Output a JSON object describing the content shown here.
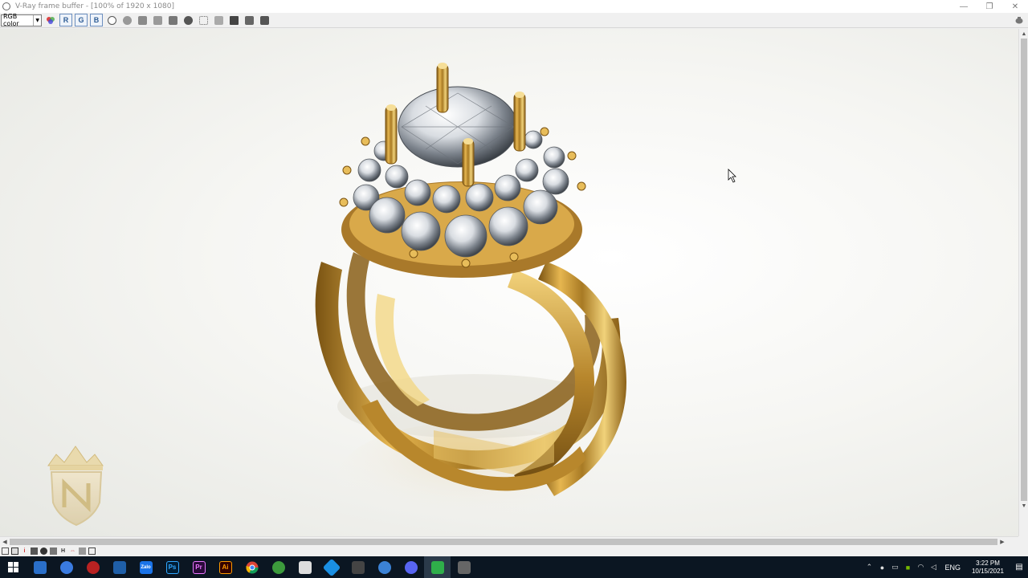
{
  "window": {
    "title": "V-Ray frame buffer - [100% of 1920 x 1080]",
    "controls": {
      "minimize": "—",
      "maximize": "❐",
      "close": "✕"
    }
  },
  "toolbar": {
    "channel": "RGB color",
    "channel_buttons": [
      "R",
      "G",
      "B"
    ]
  },
  "statusbar": {
    "glyphs": [
      "i",
      "H"
    ]
  },
  "taskbar": {
    "apps": [
      {
        "name": "start",
        "label": ""
      },
      {
        "name": "app-1",
        "label": ""
      },
      {
        "name": "app-2",
        "label": ""
      },
      {
        "name": "app-3",
        "label": ""
      },
      {
        "name": "app-4",
        "label": ""
      },
      {
        "name": "zalo",
        "label": "Zalo"
      },
      {
        "name": "photoshop",
        "label": "Ps"
      },
      {
        "name": "premiere",
        "label": "Pr"
      },
      {
        "name": "illustrator",
        "label": "Ai"
      },
      {
        "name": "chrome",
        "label": ""
      }
    ],
    "language": "ENG",
    "time": "3:22 PM",
    "date": "10/15/2021"
  },
  "colors": {
    "gold": "#c9962f",
    "gold_light": "#f1d27a",
    "gold_dark": "#7a5312",
    "taskbar": "#0b1622"
  }
}
